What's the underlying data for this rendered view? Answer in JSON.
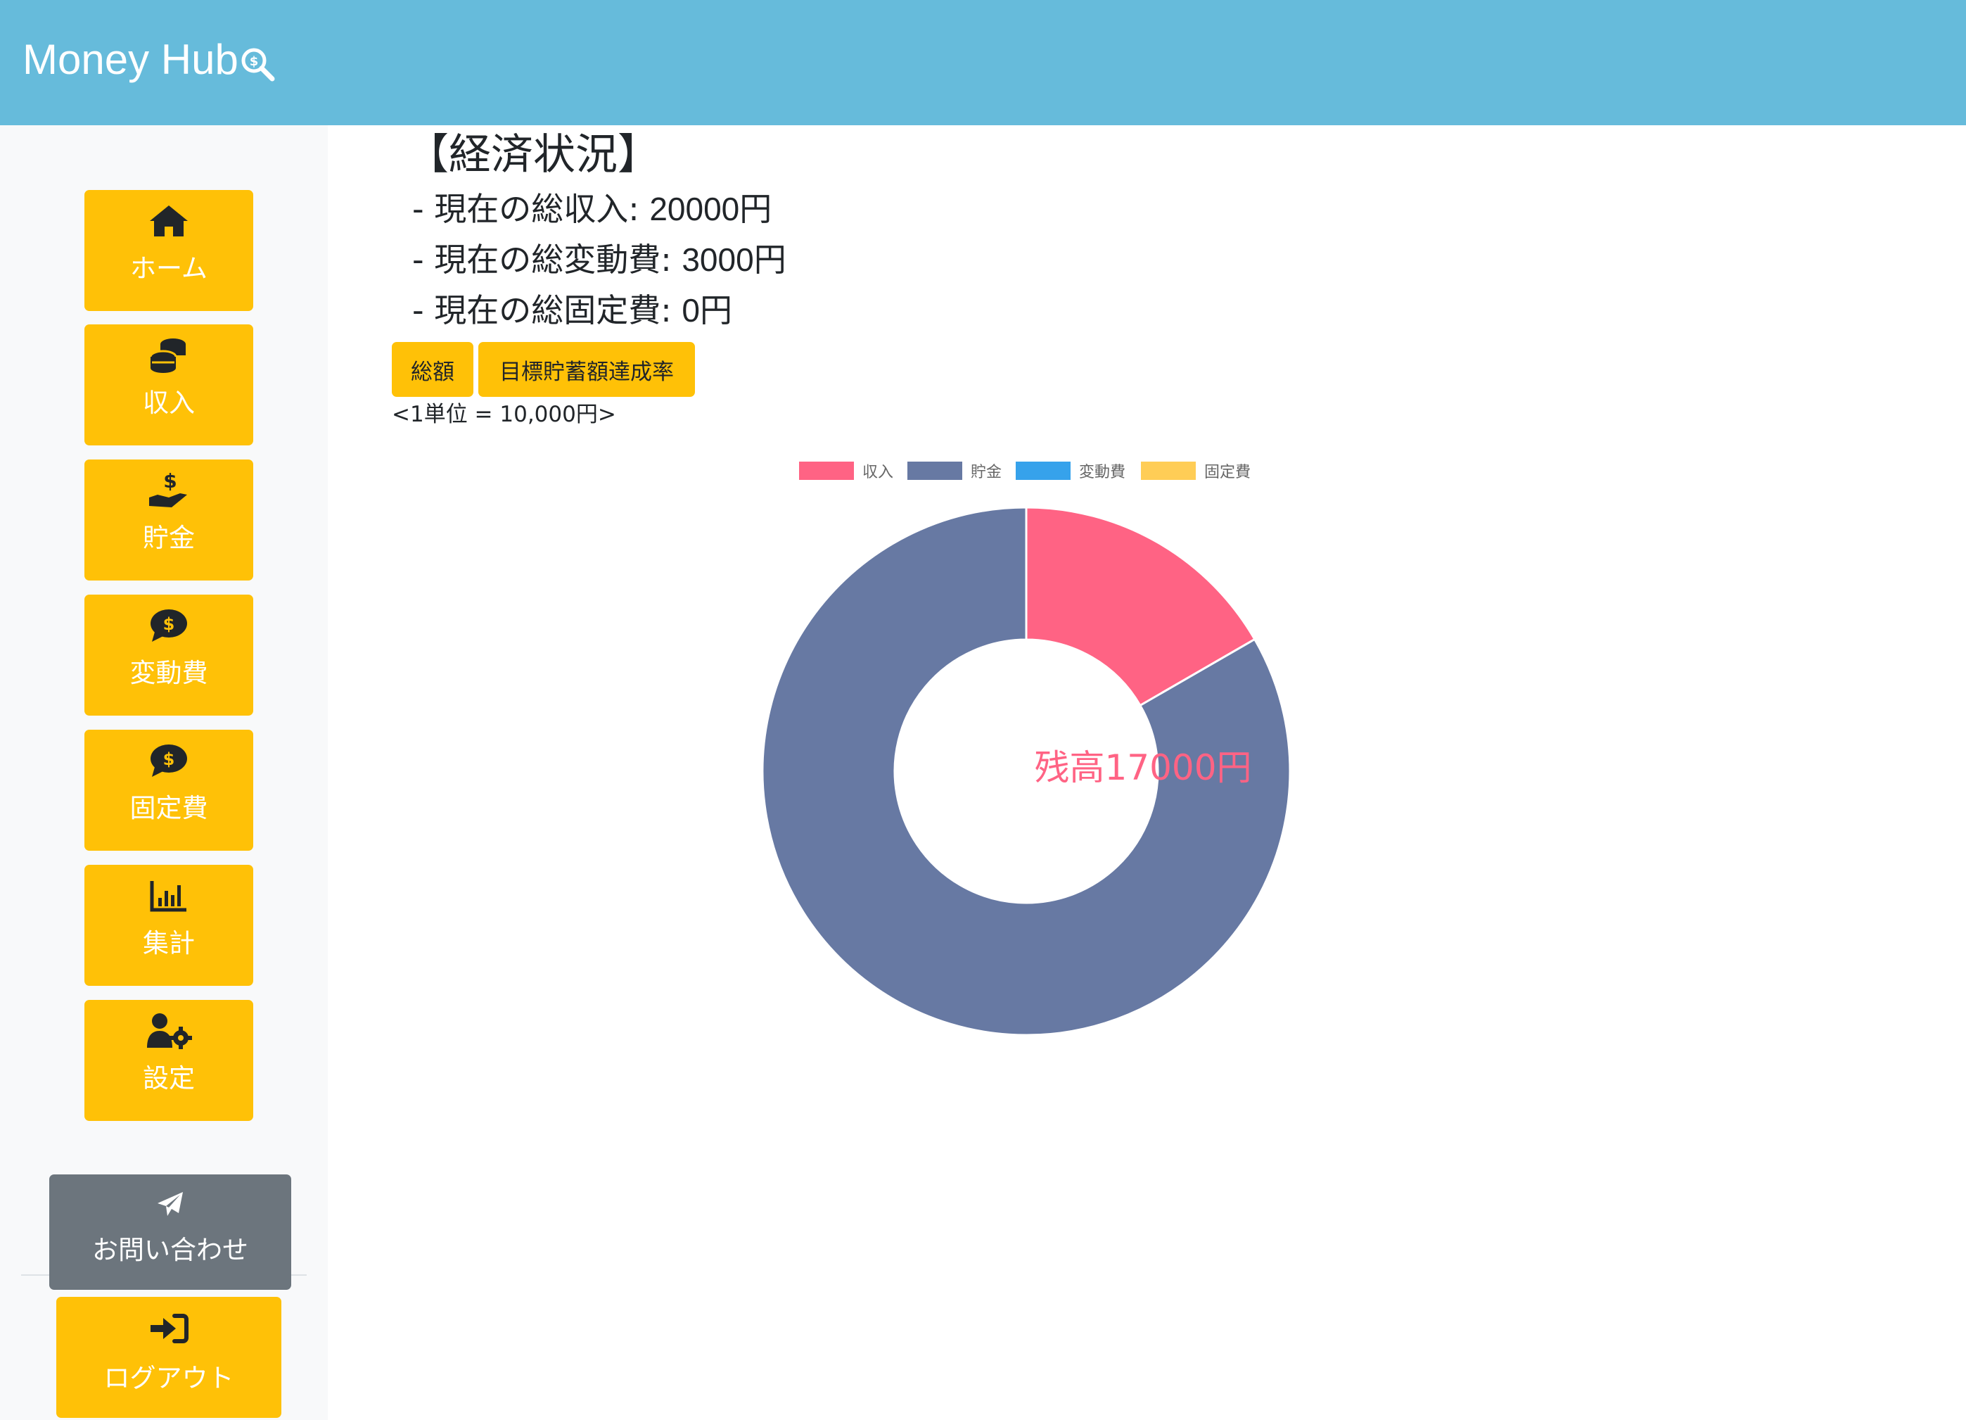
{
  "app": {
    "brand": "Money Hub"
  },
  "sidebar": {
    "items": [
      {
        "label": "ホーム",
        "icon": "home-icon"
      },
      {
        "label": "収入",
        "icon": "coins-icon"
      },
      {
        "label": "貯金",
        "icon": "hand-holding-dollar-icon"
      },
      {
        "label": "変動費",
        "icon": "comment-dollar-icon"
      },
      {
        "label": "固定費",
        "icon": "comment-dollar-icon"
      },
      {
        "label": "集計",
        "icon": "chart-column-icon"
      },
      {
        "label": "設定",
        "icon": "user-gear-icon"
      }
    ],
    "contact": {
      "label": "お問い合わせ",
      "icon": "paper-plane-icon"
    },
    "logout": {
      "label": "ログアウト",
      "icon": "sign-in-icon"
    }
  },
  "main": {
    "title": "【経済状況】",
    "stats": [
      {
        "prefix": "- 現在の総収入: ",
        "value": "20000",
        "suffix": "円"
      },
      {
        "prefix": "- 現在の総変動費: ",
        "value": "3000",
        "suffix": "円"
      },
      {
        "prefix": "- 現在の総固定費: ",
        "value": "0",
        "suffix": "円"
      }
    ],
    "tabs": [
      "総額",
      "目標貯蓄額達成率"
    ],
    "unit_note": "<1単位 = 10,000円>",
    "center_label": "残高17000円"
  },
  "colors": {
    "navbar": "#66bbdb",
    "button": "#ffc107",
    "contact_button": "#6c757d",
    "income": "#ff6384",
    "savings": "#6779a3",
    "variable": "#36a2eb",
    "fixed": "#ffcd56"
  },
  "chart_data": {
    "type": "pie",
    "variant": "doughnut",
    "labels": [
      "収入",
      "貯金",
      "変動費",
      "固定費"
    ],
    "values": [
      2,
      10,
      0,
      0
    ],
    "colors": [
      "#ff6384",
      "#6779a3",
      "#36a2eb",
      "#ffcd56"
    ],
    "legend": "top",
    "center_text": "残高17000円"
  }
}
